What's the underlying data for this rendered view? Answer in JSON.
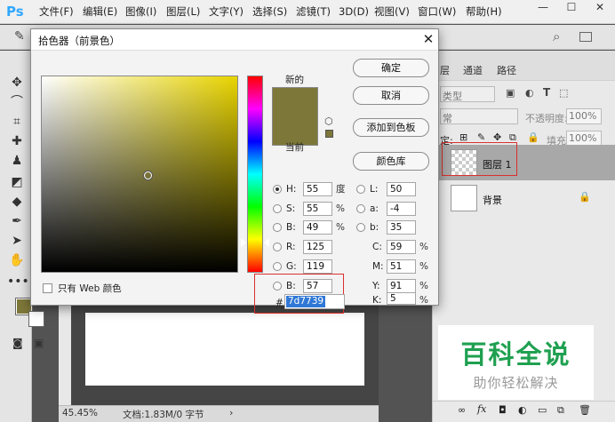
{
  "app": {
    "logo": "Ps"
  },
  "menu": [
    "文件(F)",
    "编辑(E)",
    "图像(I)",
    "图层(L)",
    "文字(Y)",
    "选择(S)",
    "滤镜(T)",
    "3D(D)",
    "视图(V)",
    "窗口(W)",
    "帮助(H)"
  ],
  "window_controls": {
    "minimize": "—",
    "restore": "☐",
    "close": "✕"
  },
  "dialog": {
    "title": "拾色器（前景色）",
    "close": "✕",
    "new_label": "新的",
    "current_label": "当前",
    "buttons": {
      "ok": "确定",
      "cancel": "取消",
      "add_swatch": "添加到色板",
      "libraries": "颜色库"
    },
    "web_only_label": "只有 Web 颜色",
    "fields": {
      "H": {
        "label": "H:",
        "value": "55",
        "unit": "度"
      },
      "S": {
        "label": "S:",
        "value": "55",
        "unit": "%"
      },
      "B": {
        "label": "B:",
        "value": "49",
        "unit": "%"
      },
      "R": {
        "label": "R:",
        "value": "125"
      },
      "G": {
        "label": "G:",
        "value": "119"
      },
      "Bl": {
        "label": "B:",
        "value": "57"
      },
      "L": {
        "label": "L:",
        "value": "50"
      },
      "a": {
        "label": "a:",
        "value": "-4"
      },
      "b": {
        "label": "b:",
        "value": "35"
      },
      "C": {
        "label": "C:",
        "value": "59",
        "unit": "%"
      },
      "M": {
        "label": "M:",
        "value": "51",
        "unit": "%"
      },
      "Y": {
        "label": "Y:",
        "value": "91",
        "unit": "%"
      },
      "K": {
        "label": "K:",
        "value": "5",
        "unit": "%"
      }
    },
    "hex_label": "#",
    "hex_value": "7d7739",
    "colors": {
      "new": "#7d7739",
      "current": "#7d7739",
      "field_hue": "#e8d400",
      "highlight": "#d9302c"
    }
  },
  "layers_panel": {
    "tabs": [
      "层",
      "通道",
      "路径"
    ],
    "kind_label": "类型",
    "blend_mode": "常",
    "opacity_label": "不透明度:",
    "opacity_value": "100%",
    "lock_label": "定:",
    "fill_label": "填充:",
    "fill_value": "100%",
    "layers": [
      {
        "name": "图层 1"
      },
      {
        "name": "背景"
      }
    ]
  },
  "status": {
    "zoom": "45.45%",
    "doc_info": "文档:1.83M/0 字节"
  },
  "watermark": {
    "title": "百科全说",
    "subtitle": "助你轻松解决"
  },
  "icons": [
    "move-icon",
    "lasso-icon",
    "crop-icon",
    "healing-icon",
    "stamp-icon",
    "eraser-icon",
    "drop-icon",
    "pen-icon",
    "select-arrow-icon",
    "hand-icon",
    "more-icon",
    "eyedropper-icon",
    "search-icon",
    "lock-icon",
    "cube-icon"
  ]
}
